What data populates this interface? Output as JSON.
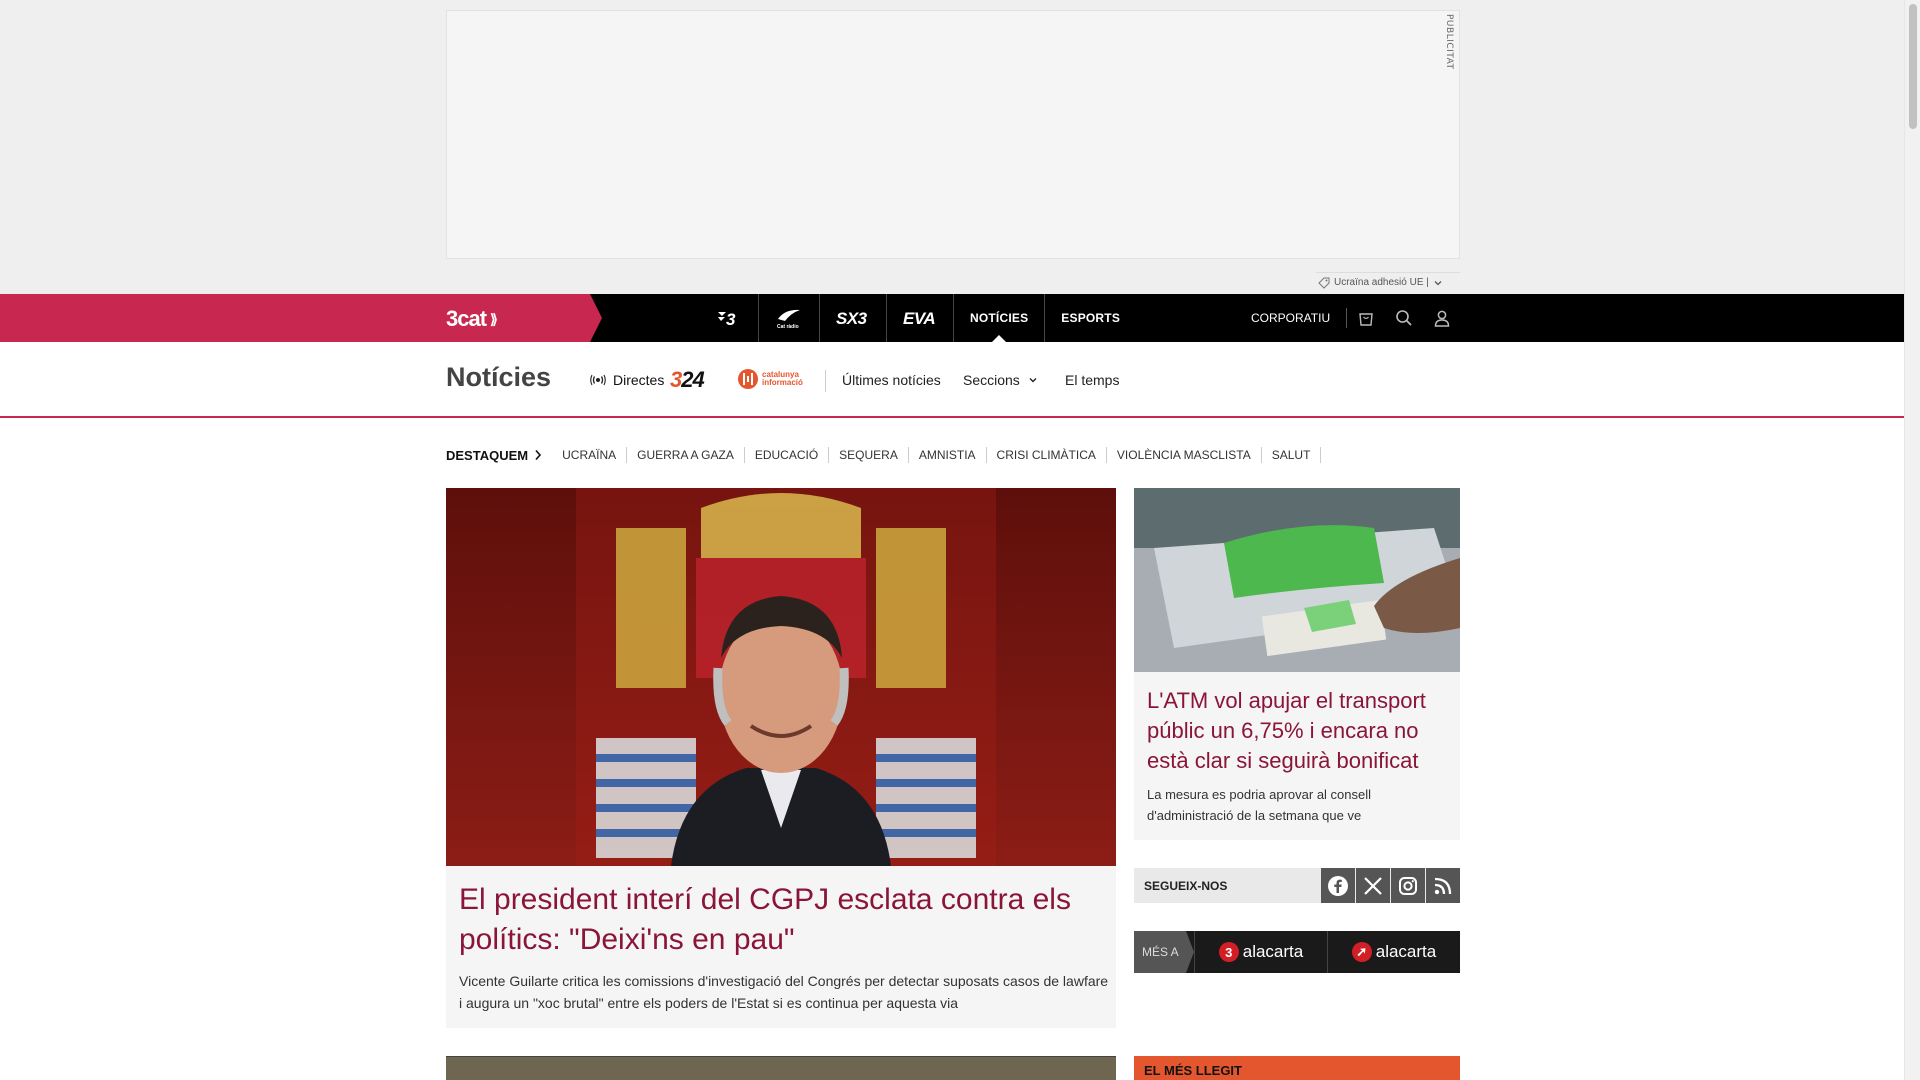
{
  "ad": {
    "label": "PUBLICITAT",
    "tag_text": "Ucraïna adhesió UE |"
  },
  "topbar": {
    "brand": "3cat",
    "channels": [
      {
        "label": "3",
        "kind": "logo"
      },
      {
        "label": "Cat ràdio",
        "kind": "logo"
      },
      {
        "label": "SX3",
        "kind": "logo"
      },
      {
        "label": "EVA",
        "kind": "logo"
      }
    ],
    "nav": [
      "NOTÍCIES",
      "ESPORTS"
    ],
    "corporate": "CORPORATIU",
    "accent": "#c8284f"
  },
  "section": {
    "title": "Notícies",
    "directes": "Directes",
    "logo_324_a": "3",
    "logo_324_b": "24",
    "logo_ci_line1": "catalunya",
    "logo_ci_line2": "informació",
    "links": [
      "Últimes notícies",
      "Seccions",
      "El temps"
    ]
  },
  "tags": {
    "lead": "DESTAQUEM",
    "items": [
      "UCRAÏNA",
      "GUERRA A GAZA",
      "EDUCACIÓ",
      "SEQUERA",
      "AMNISTIA",
      "CRISI CLIMÀTICA",
      "VIOLÈNCIA MASCLISTA",
      "SALUT"
    ]
  },
  "main_article": {
    "title": "El president interí del CGPJ esclata contra els polítics: \"Deixi'ns en pau\"",
    "subtitle": "Vicente Guilarte critica les comissions d'investigació del Congrés per detectar suposats casos de lawfare i augura un \"xoc brutal\" entre els poders de l'Estat si es continua per aquesta via"
  },
  "side_article": {
    "title": "L'ATM vol apujar el transport públic un 6,75% i encara no està clar si seguirà bonificat",
    "subtitle": "La mesura es podria aprovar al consell d'administració de la setmana que ve"
  },
  "follow": {
    "label": "SEGUEIX-NOS",
    "icons": [
      "facebook-icon",
      "x-icon",
      "instagram-icon",
      "rss-icon"
    ]
  },
  "mes_a": {
    "label": "MÉS A",
    "buttons": [
      "alacarta",
      "alacarta"
    ]
  },
  "most_read": {
    "label": "EL MÉS LLEGIT"
  }
}
